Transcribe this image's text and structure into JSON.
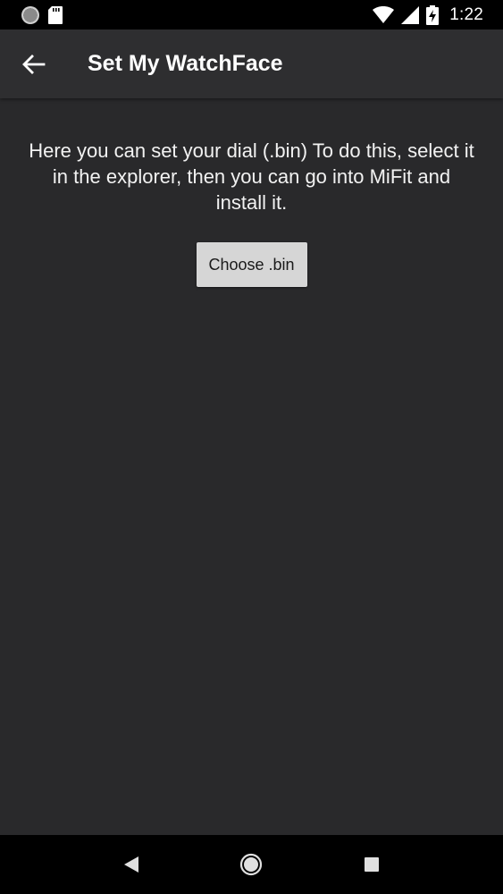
{
  "status_bar": {
    "time": "1:22",
    "icons": [
      "circle-notification-icon",
      "sd-card-icon",
      "wifi-icon",
      "signal-icon",
      "battery-charging-icon"
    ]
  },
  "app_bar": {
    "title": "Set My WatchFace",
    "back_icon": "arrow-back-icon"
  },
  "content": {
    "instructions": "Here you can set your dial (.bin) To do this, select it in the explorer, then you can go into MiFit and install it.",
    "choose_button_label": "Choose .bin"
  },
  "nav_bar": {
    "icons": [
      "back-triangle-icon",
      "home-circle-icon",
      "recents-square-icon"
    ]
  },
  "colors": {
    "background": "#29292b",
    "app_bar": "#2e2e30",
    "button": "#d6d6d6"
  }
}
